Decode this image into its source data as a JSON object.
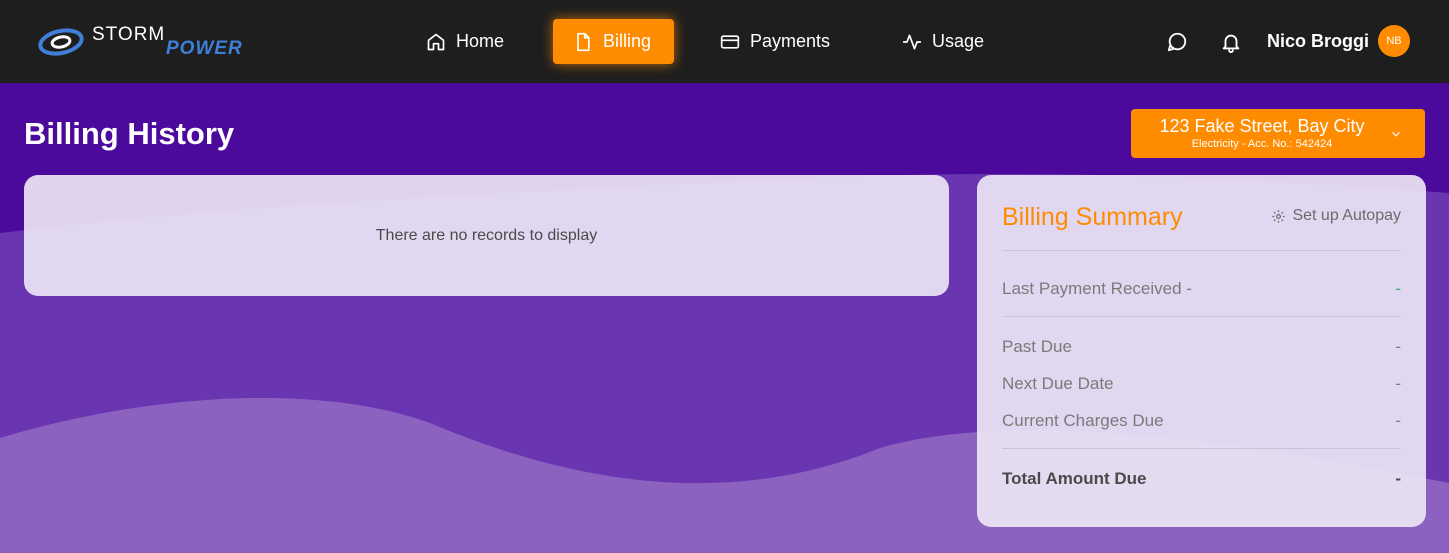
{
  "brand": {
    "word1": "STORM",
    "word2": "POWER"
  },
  "nav": {
    "home": "Home",
    "billing": "Billing",
    "payments": "Payments",
    "usage": "Usage"
  },
  "user": {
    "name": "Nico Broggi",
    "initials": "NB"
  },
  "page": {
    "title": "Billing History"
  },
  "account": {
    "address": "123 Fake Street, Bay City",
    "details": "Electricity - Acc. No.: 542424"
  },
  "records": {
    "empty_message": "There are no records to display"
  },
  "summary": {
    "title": "Billing Summary",
    "autopay_label": "Set up Autopay",
    "last_payment_label": "Last Payment Received -",
    "last_payment_value": "-",
    "past_due_label": "Past Due",
    "past_due_value": "-",
    "next_due_label": "Next Due Date",
    "next_due_value": "-",
    "current_charges_label": "Current Charges Due",
    "current_charges_value": "-",
    "total_label": "Total Amount Due",
    "total_value": "-"
  },
  "colors": {
    "accent": "#ff8c00",
    "nav_bg": "#1e1e1e",
    "page_bg": "#4c0a9c",
    "positive": "#3bb273"
  }
}
